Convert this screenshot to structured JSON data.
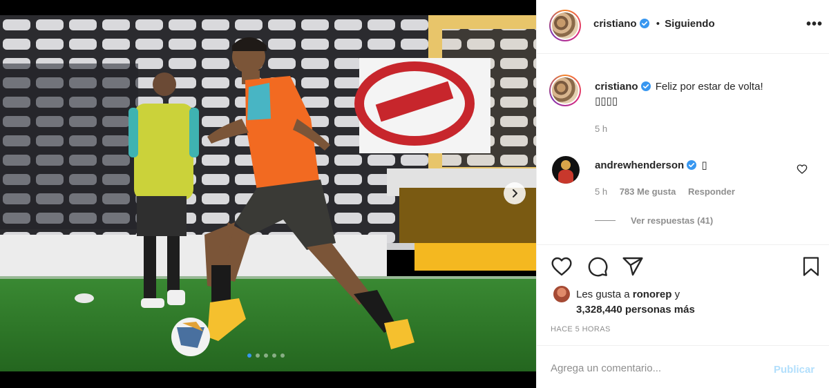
{
  "post": {
    "slide_count": 5,
    "active_slide": 1
  },
  "header": {
    "username": "cristiano",
    "separator": "•",
    "follow_status": "Siguiendo",
    "more_label": "•••"
  },
  "caption": {
    "username": "cristiano",
    "text": "Feliz por estar de volta!",
    "emoji_line": "▯▯▯▯",
    "time": "5 h"
  },
  "comment": {
    "username": "andrewhenderson",
    "text": "▯",
    "time": "5 h",
    "likes": "783 Me gusta",
    "reply_label": "Responder",
    "view_replies": "Ver respuestas (41)"
  },
  "likes": {
    "line1_prefix": "Les gusta a ",
    "line1_user": "ronorep",
    "line1_suffix": " y",
    "line2_count": "3,328,440 personas más"
  },
  "timestamp": "HACE 5 HORAS",
  "comment_box": {
    "placeholder": "Agrega un comentario...",
    "publish_label": "Publicar"
  },
  "colors": {
    "verified": "#3897f0",
    "publish_disabled": "#b2dffc",
    "muted": "#8e8e8e",
    "text": "#262626",
    "vest_orange": "#f26a21",
    "vest_yellow": "#d8dd3a",
    "pitch_green": "#2f7d2a"
  },
  "icons": {
    "like": "heart-icon",
    "comment": "comment-icon",
    "share": "paper-plane-icon",
    "save": "bookmark-icon",
    "verified": "verified-badge-icon",
    "next": "chevron-right-icon"
  }
}
